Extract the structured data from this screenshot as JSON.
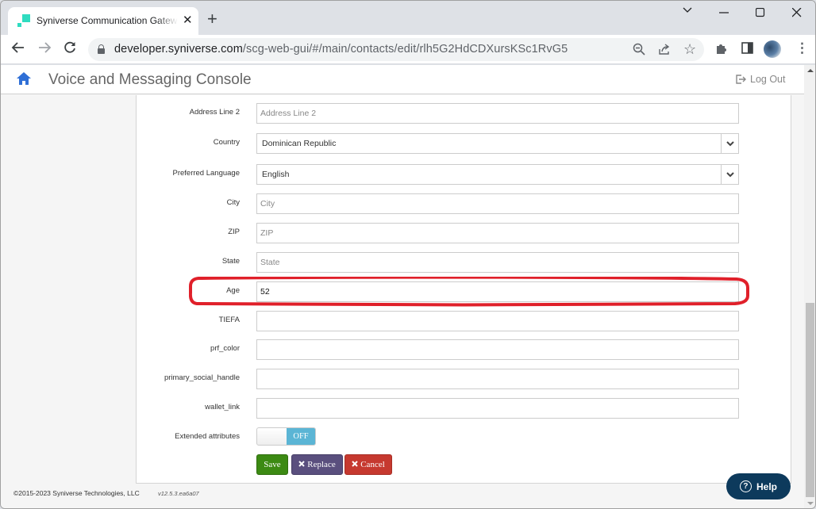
{
  "browser": {
    "tab_title": "Syniverse Communication Gateway",
    "new_tab_label": "+",
    "url_host": "developer.syniverse.com",
    "url_path": "/scg-web-gui/#/main/contacts/edit/rlh5G2HdCDXursKSc1RvG5",
    "window_controls": {
      "dropdown": "⌄",
      "minimize": "—",
      "maximize": "☐",
      "close": "✕"
    },
    "icons": {
      "back": "←",
      "forward": "→",
      "reload": "↻",
      "zoom": "zoom-out-icon",
      "share": "share-icon",
      "bookmark": "☆",
      "extensions": "puzzle-icon",
      "sidepanel": "side-panel-icon",
      "menu": "⋮"
    }
  },
  "app": {
    "title": "Voice and Messaging Console",
    "logout_label": "Log Out",
    "accent_color": "#2f6fd6"
  },
  "form": {
    "fields": [
      {
        "label": "Address Line 2",
        "type": "text",
        "value": "",
        "placeholder": "Address Line 2"
      },
      {
        "label": "Country",
        "type": "select",
        "value": "Dominican Republic"
      },
      {
        "label": "Preferred Language",
        "type": "select",
        "value": "English"
      },
      {
        "label": "City",
        "type": "text",
        "value": "",
        "placeholder": "City"
      },
      {
        "label": "ZIP",
        "type": "text",
        "value": "",
        "placeholder": "ZIP"
      },
      {
        "label": "State",
        "type": "text",
        "value": "",
        "placeholder": "State"
      },
      {
        "label": "Age",
        "type": "text",
        "value": "52",
        "placeholder": "",
        "highlighted": true
      },
      {
        "label": "TIEFA",
        "type": "text",
        "value": "",
        "placeholder": ""
      },
      {
        "label": "prf_color",
        "type": "text",
        "value": "",
        "placeholder": ""
      },
      {
        "label": "primary_social_handle",
        "type": "text",
        "value": "",
        "placeholder": ""
      },
      {
        "label": "wallet_link",
        "type": "text",
        "value": "",
        "placeholder": ""
      }
    ],
    "extended_attributes": {
      "label": "Extended attributes",
      "state": "OFF"
    },
    "buttons": {
      "save": "Save",
      "replace": "Replace",
      "cancel": "Cancel"
    },
    "button_colors": {
      "save": "#3c8a13",
      "replace": "#5a4f7e",
      "cancel": "#c6392f"
    },
    "highlight_color": "#e0202a"
  },
  "footer": {
    "copyright": "©2015-2023 Syniverse Technologies, LLC",
    "version": "v12.5.3.ea6a07"
  },
  "help": {
    "label": "Help"
  }
}
